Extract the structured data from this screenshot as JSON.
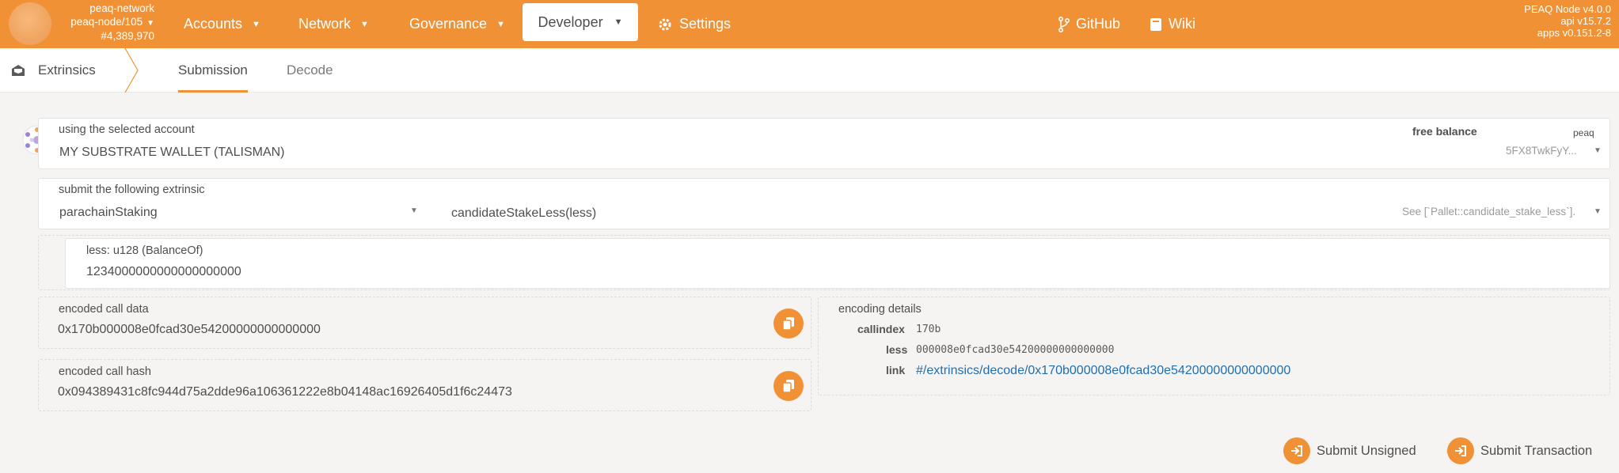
{
  "header": {
    "chain_name": "peaq-network",
    "node": "peaq-node/105",
    "block": "#4,389,970",
    "nav": {
      "accounts": "Accounts",
      "network": "Network",
      "governance": "Governance",
      "developer": "Developer",
      "settings": "Settings",
      "github": "GitHub",
      "wiki": "Wiki"
    },
    "version": {
      "node": "PEAQ Node v4.0.0",
      "api": "api v15.7.2",
      "apps": "apps v0.151.2-8"
    }
  },
  "subnav": {
    "title": "Extrinsics",
    "tabs": [
      "Submission",
      "Decode"
    ]
  },
  "account": {
    "label": "using the selected account",
    "name": "MY SUBSTRATE WALLET (TALISMAN)",
    "balance_label": "free balance",
    "balance_unit": "peaq",
    "address": "5FX8TwkFyY..."
  },
  "extrinsic": {
    "label": "submit the following extrinsic",
    "pallet": "parachainStaking",
    "call": "candidateStakeLess(less)",
    "doc": "See [`Pallet::candidate_stake_less`]."
  },
  "param": {
    "label": "less: u128 (BalanceOf)",
    "value": "1234000000000000000000"
  },
  "encoded_call_data": {
    "label": "encoded call data",
    "value": "0x170b000008e0fcad30e54200000000000000"
  },
  "encoded_call_hash": {
    "label": "encoded call hash",
    "value": "0x094389431c8fc944d75a2dde96a106361222e8b04148ac16926405d1f6c24473"
  },
  "encoding_details": {
    "label": "encoding details",
    "callindex_label": "callindex",
    "callindex": "170b",
    "less_label": "less",
    "less": "000008e0fcad30e54200000000000000",
    "link_label": "link",
    "link": "#/extrinsics/decode/0x170b000008e0fcad30e54200000000000000"
  },
  "actions": {
    "submit_unsigned": "Submit Unsigned",
    "submit_transaction": "Submit Transaction"
  },
  "colors": {
    "accent": "#f19135",
    "link": "#1f6fb0"
  }
}
